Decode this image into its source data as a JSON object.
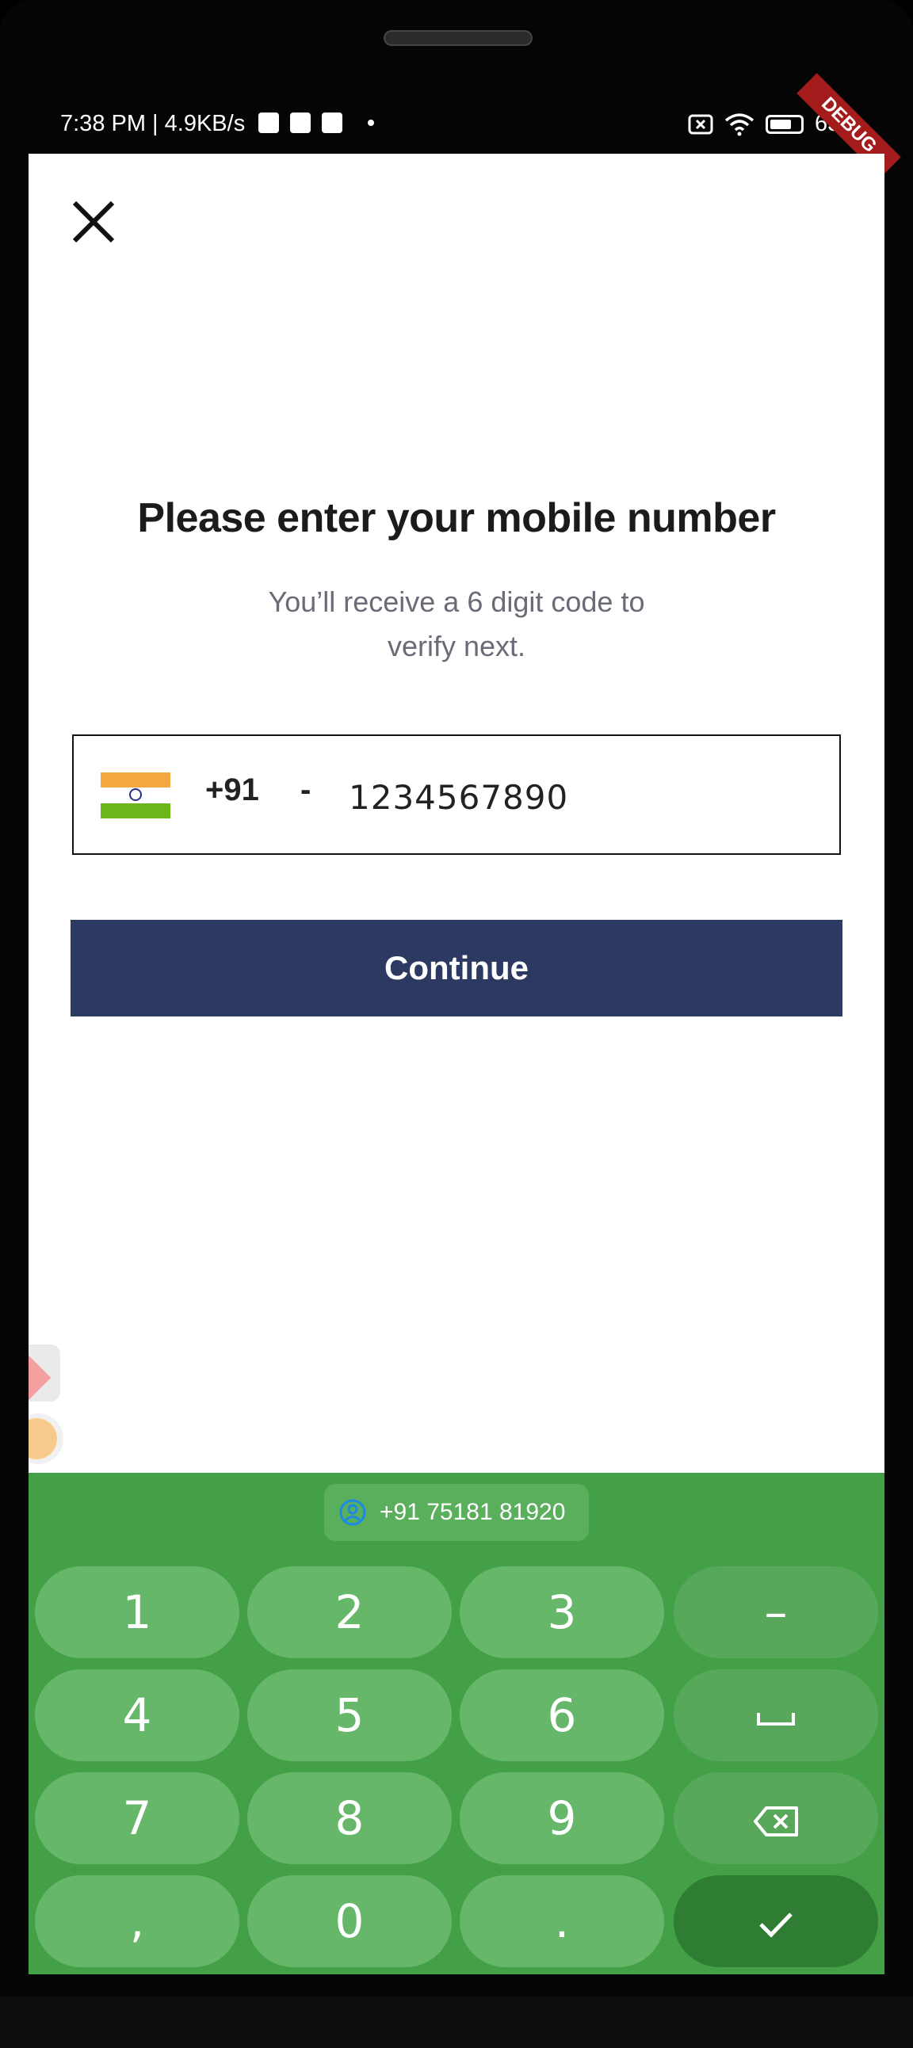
{
  "status_bar": {
    "time_text": "7:38 PM | 4.9KB/s",
    "battery_percent": "63%"
  },
  "debug_banner": "DEBUG",
  "login": {
    "title": "Please enter your mobile number",
    "subtitle": "You’ll receive a 6 digit code to verify next.",
    "country_code": "+91",
    "separator": "-",
    "phone_value": "1234567890",
    "continue_label": "Continue"
  },
  "keyboard": {
    "suggestion": "+91 75181 81920",
    "keys": [
      "1",
      "2",
      "3",
      "–",
      "4",
      "5",
      "6",
      "␣",
      "7",
      "8",
      "9",
      "⌫",
      ",",
      "0",
      ".",
      "✓"
    ],
    "accent": "#43a047",
    "key_color": "#66b769",
    "done_color": "#2e7d32"
  },
  "colors": {
    "button_bg": "#2c3a62",
    "flag_saffron": "#f5a742",
    "flag_green": "#6db61a"
  }
}
